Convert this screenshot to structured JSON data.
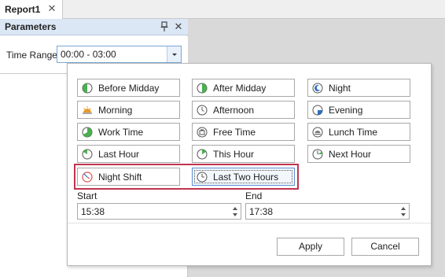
{
  "document_tab": {
    "title": "Report1"
  },
  "parameters_panel": {
    "title": "Parameters",
    "time_range_label": "Time Range",
    "time_range_value": "00:00 - 03:00"
  },
  "popup": {
    "presets": [
      {
        "label": "Before Midday",
        "icon": "before-midday-icon"
      },
      {
        "label": "After Midday",
        "icon": "after-midday-icon"
      },
      {
        "label": "Night",
        "icon": "night-icon"
      },
      {
        "label": "Morning",
        "icon": "morning-icon"
      },
      {
        "label": "Afternoon",
        "icon": "afternoon-icon"
      },
      {
        "label": "Evening",
        "icon": "evening-icon"
      },
      {
        "label": "Work Time",
        "icon": "work-time-icon"
      },
      {
        "label": "Free Time",
        "icon": "free-time-icon"
      },
      {
        "label": "Lunch Time",
        "icon": "lunch-time-icon"
      },
      {
        "label": "Last Hour",
        "icon": "last-hour-icon"
      },
      {
        "label": "This Hour",
        "icon": "this-hour-icon"
      },
      {
        "label": "Next Hour",
        "icon": "next-hour-icon"
      },
      {
        "label": "Night Shift",
        "icon": "night-shift-icon"
      },
      {
        "label": "Last Two Hours",
        "icon": "last-two-hours-icon",
        "selected": true
      }
    ],
    "start_label": "Start",
    "start_value": "15:38",
    "end_label": "End",
    "end_value": "17:38",
    "apply_label": "Apply",
    "cancel_label": "Cancel"
  },
  "colors": {
    "highlight_border": "#c0344f",
    "icon_green": "#4caf50",
    "icon_blue": "#2f6fc2",
    "icon_orange": "#e89a2c",
    "icon_red": "#d9534f"
  }
}
